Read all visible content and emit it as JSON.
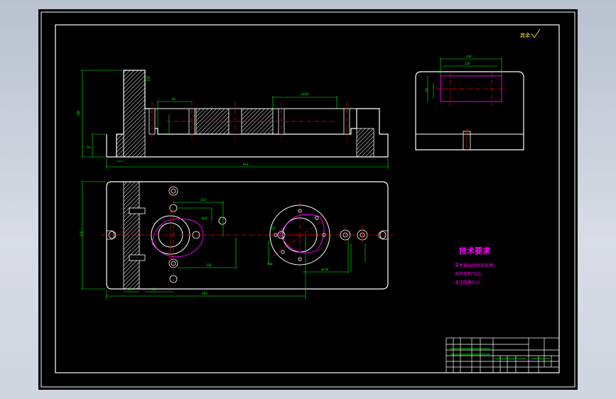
{
  "drawing": {
    "roughness_note": "其余",
    "tech_requirements": {
      "title": "技术要求",
      "lines": [
        "零件铸出后时效处理。",
        "去除毛刺飞边。",
        "未注圆角R10"
      ]
    }
  },
  "colors": {
    "background": "#000000",
    "border": "#ffffff",
    "outline": "#ffffff",
    "dimension": "#00ff00",
    "center": "#ff0000",
    "hidden": "#ff00ff",
    "tech_text": "#ff00ff",
    "hatch": "#ffffff"
  }
}
